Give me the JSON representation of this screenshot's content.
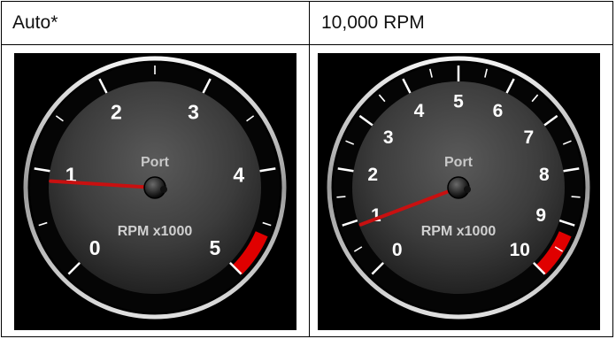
{
  "columns": [
    {
      "header": "Auto*",
      "gauge": {
        "label": "Port",
        "unit_label": "RPM x1000",
        "scale_max": 5,
        "tick_labels": [
          "0",
          "1",
          "2",
          "3",
          "4",
          "5"
        ],
        "redline_start": 4.6,
        "needle_value": 0.9
      }
    },
    {
      "header": "10,000 RPM",
      "gauge": {
        "label": "Port",
        "unit_label": "RPM x1000",
        "scale_max": 10,
        "tick_labels": [
          "0",
          "1",
          "2",
          "3",
          "4",
          "5",
          "6",
          "7",
          "8",
          "9",
          "10"
        ],
        "redline_start": 9.2,
        "needle_value": 0.9
      }
    }
  ],
  "colors": {
    "redline": "#e00000",
    "needle": "#c81010",
    "dial_face": "#3c3c3c",
    "background": "#000000"
  }
}
